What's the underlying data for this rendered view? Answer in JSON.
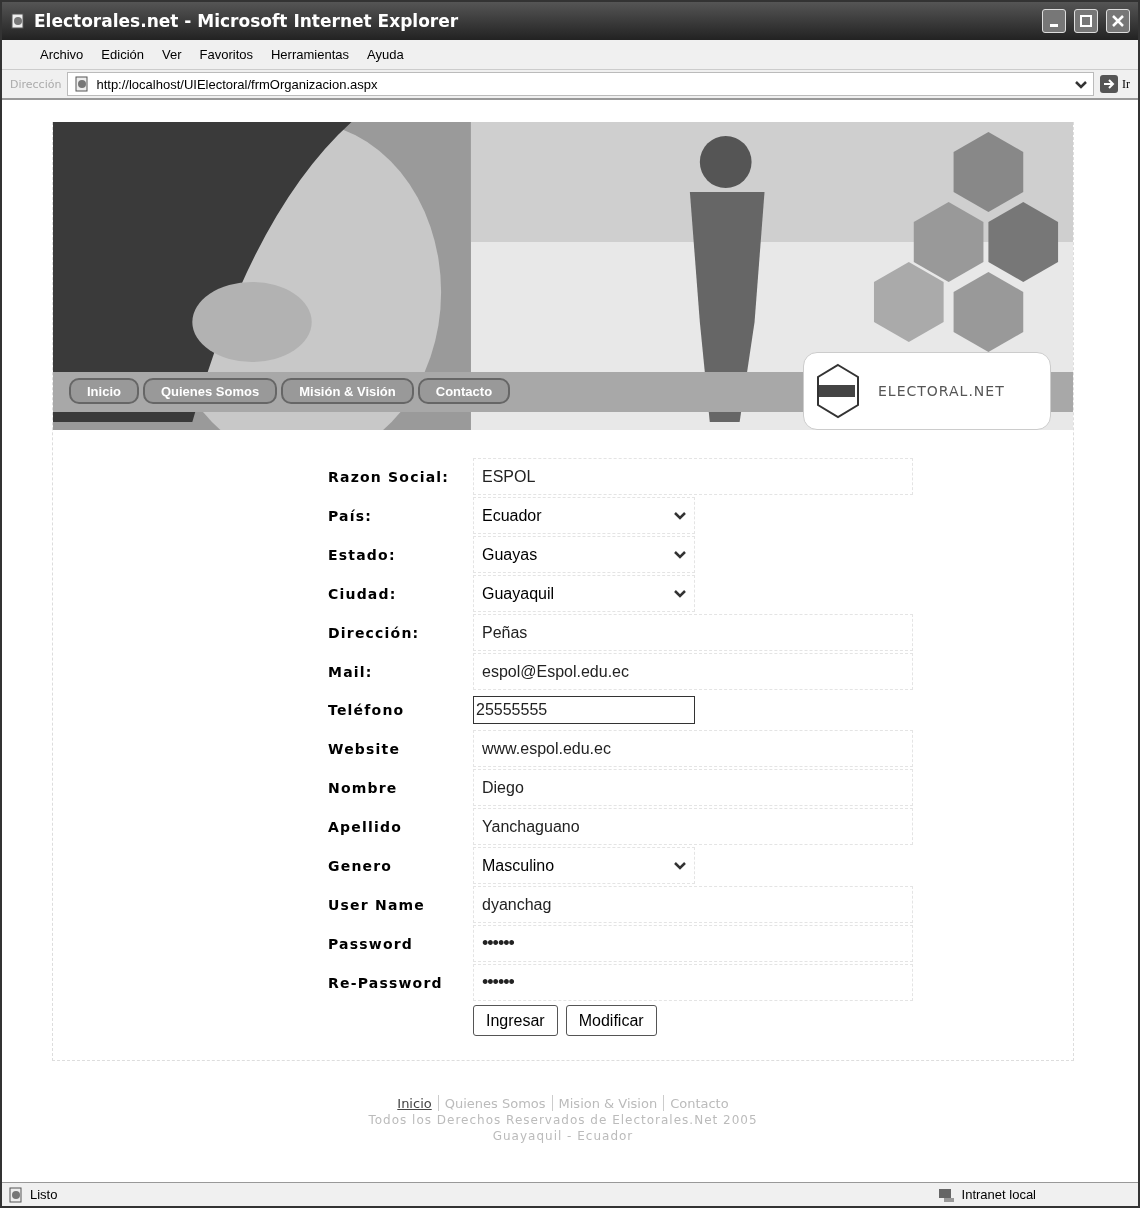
{
  "window": {
    "title": "Electorales.net - Microsoft Internet Explorer"
  },
  "menu": [
    "Archivo",
    "Edición",
    "Ver",
    "Favoritos",
    "Herramientas",
    "Ayuda"
  ],
  "address": {
    "label": "Dirección",
    "url": "http://localhost/UIElectoral/frmOrganizacion.aspx",
    "go": "Ir"
  },
  "banner": {
    "nav": [
      "Inicio",
      "Quienes Somos",
      "Misión & Visión",
      "Contacto"
    ],
    "logo": "ELECTORAL.NET"
  },
  "form": {
    "rows": [
      {
        "label": "Razon Social:",
        "kind": "text",
        "value": "ESPOL"
      },
      {
        "label": "País:",
        "kind": "select",
        "value": "Ecuador"
      },
      {
        "label": "Estado:",
        "kind": "select",
        "value": "Guayas"
      },
      {
        "label": "Ciudad:",
        "kind": "select",
        "value": "Guayaquil"
      },
      {
        "label": "Dirección:",
        "kind": "text",
        "value": "Peñas"
      },
      {
        "label": "Mail:",
        "kind": "text",
        "value": "espol@Espol.edu.ec"
      },
      {
        "label": "Teléfono",
        "kind": "active",
        "value": "25555555"
      },
      {
        "label": "Website",
        "kind": "text",
        "value": "www.espol.edu.ec"
      },
      {
        "label": "Nombre",
        "kind": "text",
        "value": "Diego"
      },
      {
        "label": "Apellido",
        "kind": "text",
        "value": "Yanchaguano"
      },
      {
        "label": "Genero",
        "kind": "select",
        "value": "Masculino"
      },
      {
        "label": "User Name",
        "kind": "text",
        "value": "dyanchag"
      },
      {
        "label": "Password",
        "kind": "password",
        "value": "••••••"
      },
      {
        "label": "Re-Password",
        "kind": "password",
        "value": "••••••"
      }
    ],
    "buttons": [
      "Ingresar",
      "Modificar"
    ]
  },
  "footer": {
    "links": [
      {
        "label": "Inicio",
        "selected": true
      },
      {
        "label": "Quienes Somos",
        "selected": false
      },
      {
        "label": "Mision & Vision",
        "selected": false
      },
      {
        "label": "Contacto",
        "selected": false
      }
    ],
    "copyright": "Todos los Derechos Reservados de Electorales.Net 2005",
    "place": "Guayaquil - Ecuador"
  },
  "status_bar": {
    "status": "Listo",
    "zone": "Intranet local"
  }
}
